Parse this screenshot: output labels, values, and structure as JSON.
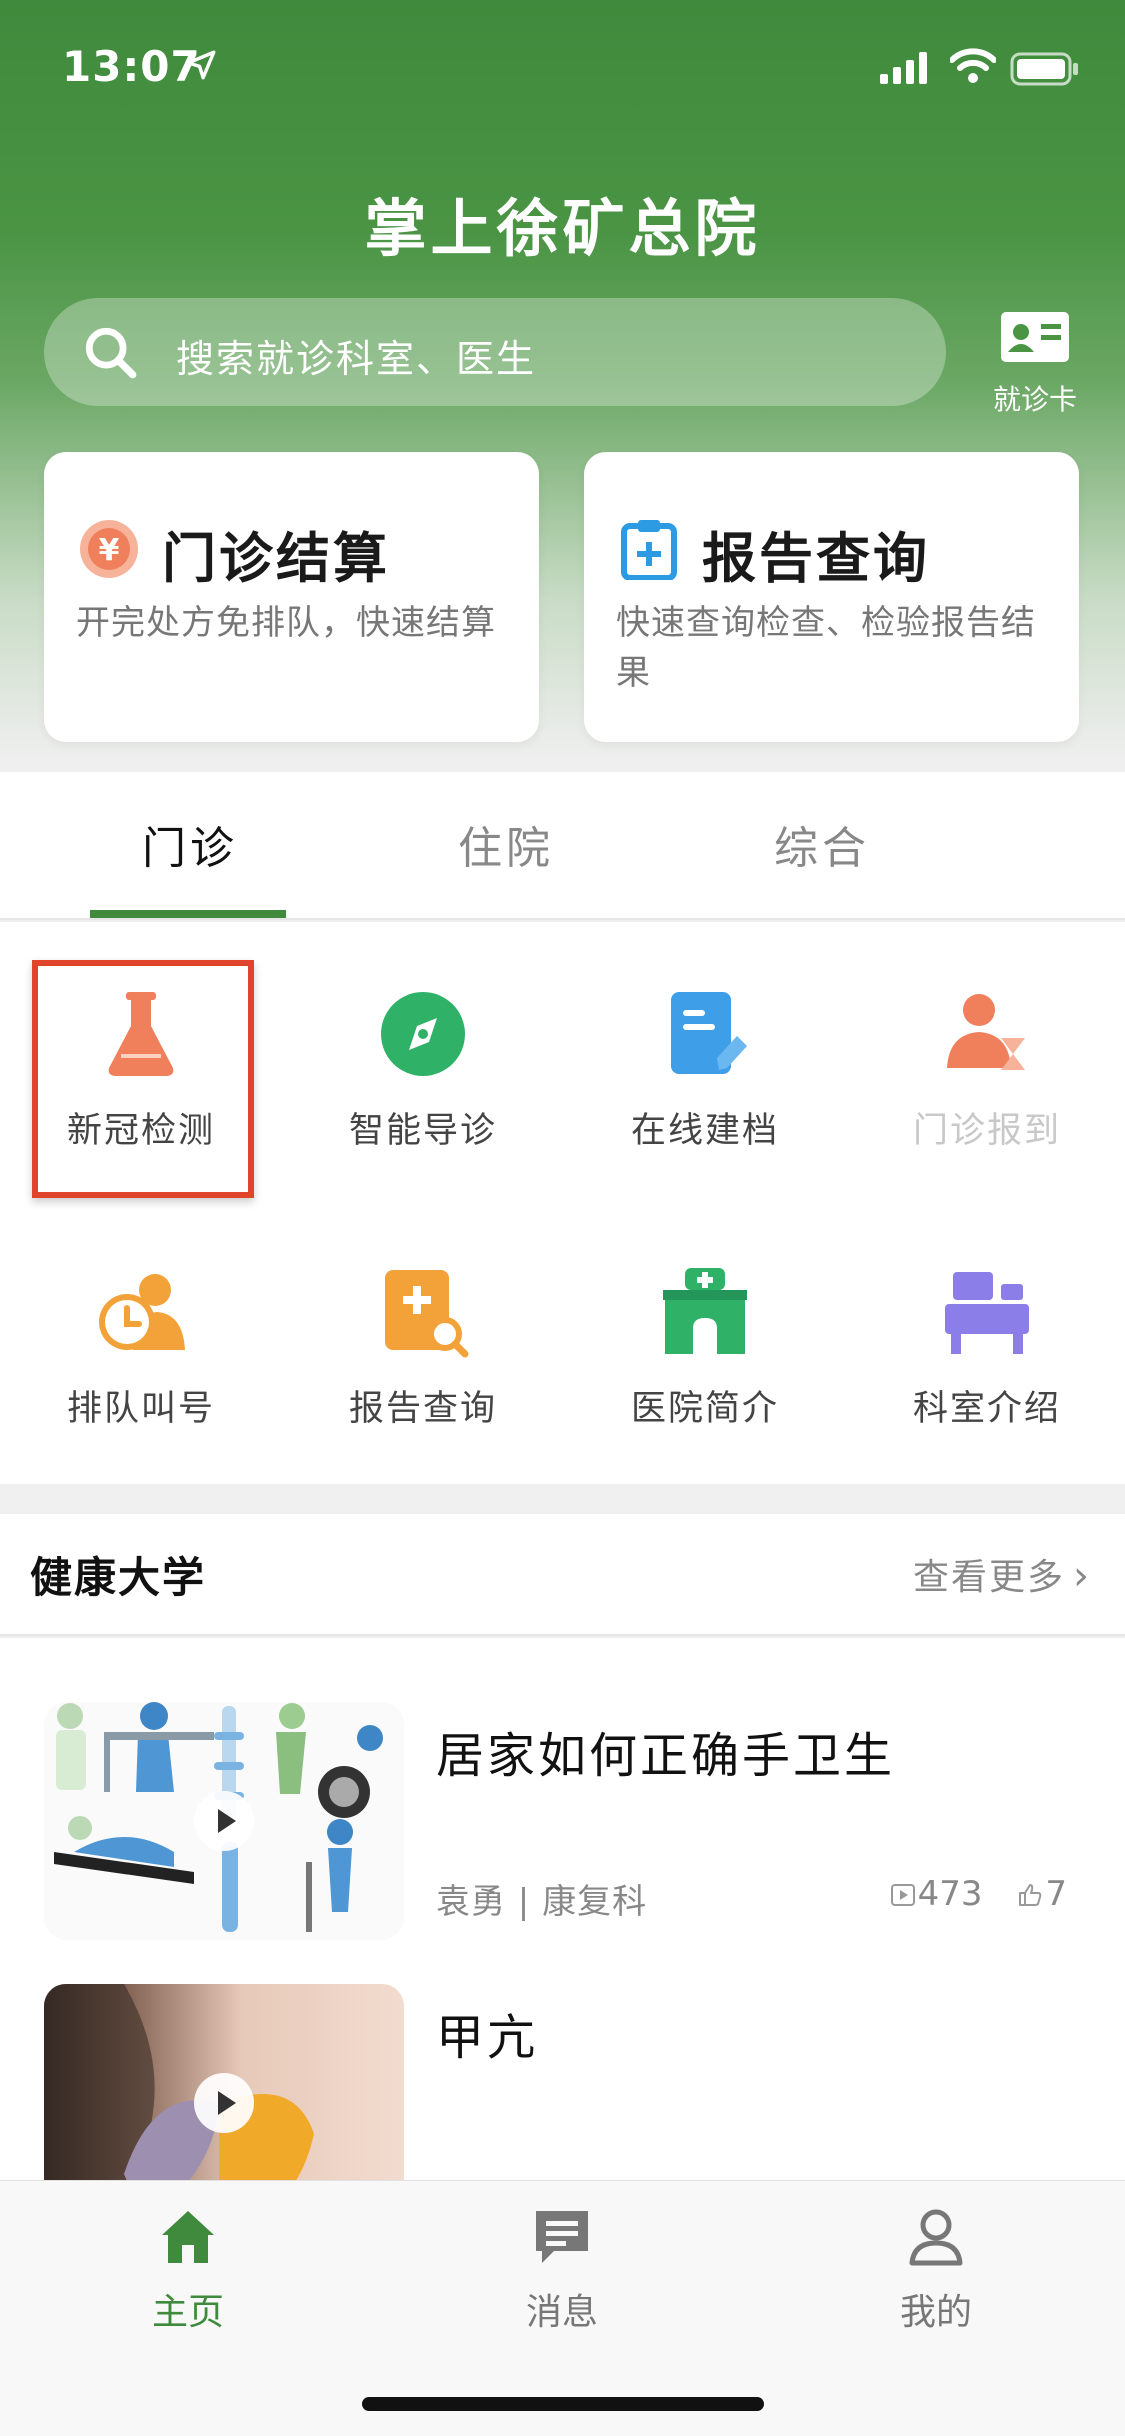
{
  "status_bar": {
    "time": "13:07"
  },
  "header": {
    "title": "掌上徐矿总院"
  },
  "search": {
    "placeholder": "搜索就诊科室、医生"
  },
  "card_button": {
    "label": "就诊卡"
  },
  "quick_cards": [
    {
      "title": "门诊结算",
      "desc": "开完处方免排队，快速结算",
      "icon": "yuan-coin-icon"
    },
    {
      "title": "报告查询",
      "desc": "快速查询检查、检验报告结果",
      "icon": "clipboard-plus-icon"
    }
  ],
  "tabs": [
    {
      "label": "门诊",
      "active": true
    },
    {
      "label": "住院",
      "active": false
    },
    {
      "label": "综合",
      "active": false
    }
  ],
  "grid": [
    {
      "label": "新冠检测",
      "icon": "flask-icon",
      "highlighted": true
    },
    {
      "label": "智能导诊",
      "icon": "compass-icon"
    },
    {
      "label": "在线建档",
      "icon": "document-edit-icon"
    },
    {
      "label": "门诊报到",
      "icon": "person-hourglass-icon",
      "disabled": true
    },
    {
      "label": "排队叫号",
      "icon": "queue-clock-icon"
    },
    {
      "label": "报告查询",
      "icon": "report-search-icon"
    },
    {
      "label": "医院简介",
      "icon": "hospital-icon"
    },
    {
      "label": "科室介绍",
      "icon": "department-desk-icon"
    }
  ],
  "section": {
    "title": "健康大学",
    "more": "查看更多"
  },
  "articles": [
    {
      "title": "居家如何正确手卫生",
      "meta": "袁勇 | 康复科",
      "views": "473",
      "likes": "7"
    },
    {
      "title": "甲亢",
      "meta": "",
      "views": "",
      "likes": ""
    }
  ],
  "tabbar": [
    {
      "label": "主页",
      "icon": "home-icon",
      "active": true
    },
    {
      "label": "消息",
      "icon": "message-icon",
      "active": false
    },
    {
      "label": "我的",
      "icon": "user-icon",
      "active": false
    }
  ],
  "colors": {
    "primary": "#3f8a3c",
    "highlight": "#e0452c",
    "orange": "#f07f5b",
    "blue": "#3f9ee8",
    "green": "#2fb168",
    "purple": "#8c7ee8"
  }
}
